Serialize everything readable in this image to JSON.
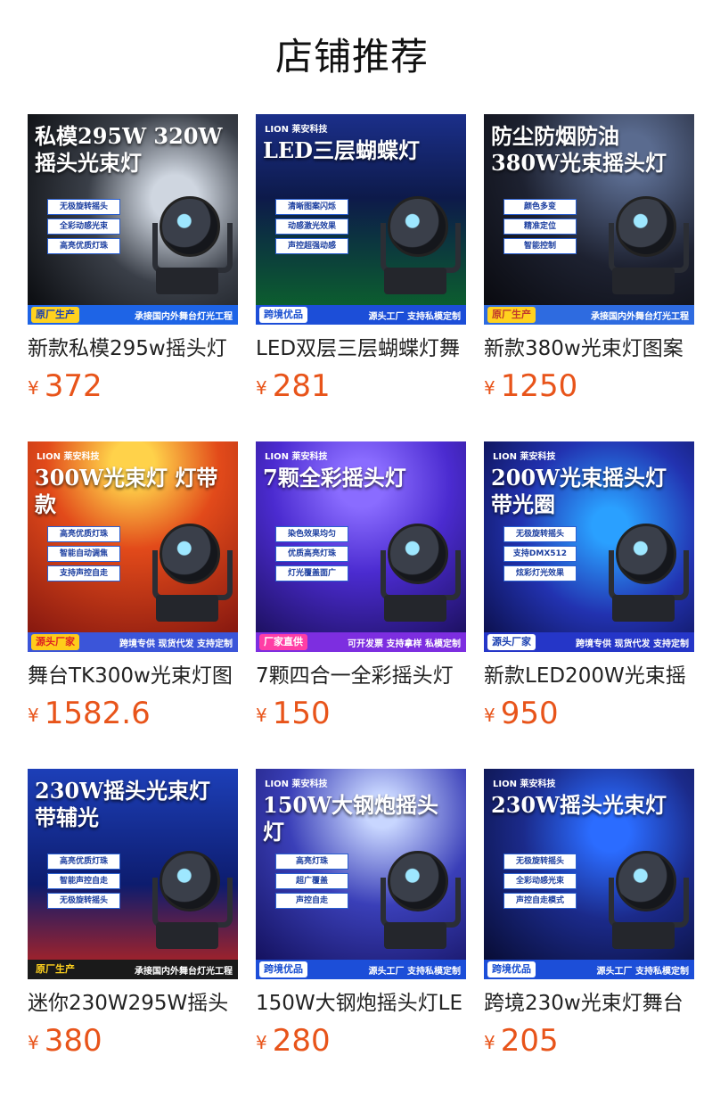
{
  "header": {
    "title": "店铺推荐"
  },
  "colors": {
    "price": "#e8541a"
  },
  "products": [
    {
      "title": "新款私模295w摇头灯",
      "currency": "¥",
      "price": "372",
      "image": {
        "brand": "",
        "headline": "私模295W 320W 摇头光束灯",
        "features": [
          "无极旋转摇头",
          "全彩动感光束",
          "高亮优质灯珠"
        ],
        "tag": "原厂生产",
        "slogan": "承接国内外舞台灯光工程"
      }
    },
    {
      "title": "LED双层三层蝴蝶灯舞",
      "currency": "¥",
      "price": "281",
      "image": {
        "brand": "LION 莱安科技",
        "headline": "LED三层蝴蝶灯",
        "features": [
          "清晰图案闪烁",
          "动感激光效果",
          "声控超强动感"
        ],
        "tag": "跨境优品",
        "slogan": "源头工厂 支持私模定制"
      }
    },
    {
      "title": "新款380w光束灯图案",
      "currency": "¥",
      "price": "1250",
      "image": {
        "brand": "",
        "headline": "防尘防烟防油 380W光束摇头灯",
        "features": [
          "颜色多变",
          "精准定位",
          "智能控制"
        ],
        "tag": "原厂生产",
        "slogan": "承接国内外舞台灯光工程"
      }
    },
    {
      "title": "舞台TK300w光束灯图",
      "currency": "¥",
      "price": "1582.6",
      "image": {
        "brand": "LION 莱安科技",
        "headline": "300W光束灯 灯带款",
        "features": [
          "高亮优质灯珠",
          "智能自动调焦",
          "支持声控自走"
        ],
        "tag": "源头厂家",
        "slogan": "跨境专供 现货代发 支持定制"
      }
    },
    {
      "title": "7颗四合一全彩摇头灯",
      "currency": "¥",
      "price": "150",
      "image": {
        "brand": "LION 莱安科技",
        "headline": "7颗全彩摇头灯",
        "features": [
          "染色效果均匀",
          "优质高亮灯珠",
          "灯光覆盖面广"
        ],
        "tag": "厂家直供",
        "slogan": "可开发票 支持拿样 私模定制"
      }
    },
    {
      "title": "新款LED200W光束摇",
      "currency": "¥",
      "price": "950",
      "image": {
        "brand": "LION 莱安科技",
        "headline": "200W光束摇头灯 带光圈",
        "features": [
          "无极旋转摇头",
          "支持DMX512",
          "炫彩灯光效果"
        ],
        "tag": "源头厂家",
        "slogan": "跨境专供 现货代发 支持定制"
      }
    },
    {
      "title": "迷你230W295W摇头",
      "currency": "¥",
      "price": "380",
      "image": {
        "brand": "",
        "headline": "230W摇头光束灯 带辅光",
        "features": [
          "高亮优质灯珠",
          "智能声控自走",
          "无极旋转摇头"
        ],
        "tag": "原厂生产",
        "slogan": "承接国内外舞台灯光工程"
      }
    },
    {
      "title": "150W大钢炮摇头灯LE",
      "currency": "¥",
      "price": "280",
      "image": {
        "brand": "LION 莱安科技",
        "headline": "150W大钢炮摇头灯",
        "features": [
          "高亮灯珠",
          "超广覆盖",
          "声控自走"
        ],
        "tag": "跨境优品",
        "slogan": "源头工厂 支持私模定制"
      }
    },
    {
      "title": "跨境230w光束灯舞台",
      "currency": "¥",
      "price": "205",
      "image": {
        "brand": "LION 莱安科技",
        "headline": "230W摇头光束灯",
        "features": [
          "无极旋转摇头",
          "全彩动感光束",
          "声控自走模式"
        ],
        "tag": "跨境优品",
        "slogan": "源头工厂 支持私模定制"
      }
    }
  ]
}
